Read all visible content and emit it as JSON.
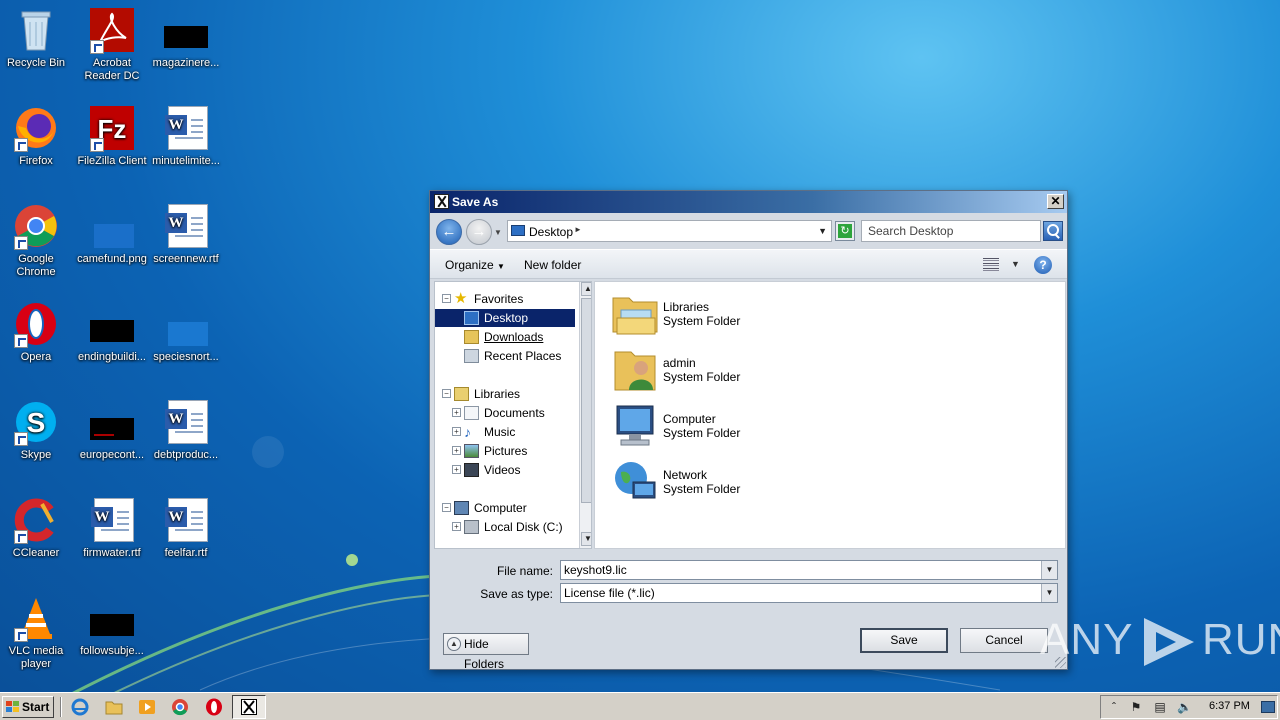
{
  "desktop": {
    "icons": [
      {
        "label": "Recycle Bin",
        "icon": "recycle-bin-icon"
      },
      {
        "label": "Acrobat Reader DC",
        "icon": "acrobat-reader-icon"
      },
      {
        "label": "magazinere...",
        "icon": "redacted-file-icon"
      },
      {
        "label": "Firefox",
        "icon": "firefox-icon"
      },
      {
        "label": "FileZilla Client",
        "icon": "filezilla-icon"
      },
      {
        "label": "minutelimite...",
        "icon": "word-document-icon"
      },
      {
        "label": "Google Chrome",
        "icon": "chrome-icon"
      },
      {
        "label": "camefund.png",
        "icon": "image-file-icon"
      },
      {
        "label": "screennew.rtf",
        "icon": "word-document-icon"
      },
      {
        "label": "Opera",
        "icon": "opera-icon"
      },
      {
        "label": "endingbuildi...",
        "icon": "redacted-file-icon"
      },
      {
        "label": "speciesnort...",
        "icon": "image-file-icon"
      },
      {
        "label": "Skype",
        "icon": "skype-icon"
      },
      {
        "label": "europecont...",
        "icon": "redacted-file-icon"
      },
      {
        "label": "debtproduc...",
        "icon": "word-document-icon"
      },
      {
        "label": "CCleaner",
        "icon": "ccleaner-icon"
      },
      {
        "label": "firmwater.rtf",
        "icon": "word-document-icon"
      },
      {
        "label": "feelfar.rtf",
        "icon": "word-document-icon"
      },
      {
        "label": "VLC media player",
        "icon": "vlc-icon"
      },
      {
        "label": "followsubje...",
        "icon": "redacted-file-icon"
      }
    ]
  },
  "dialog": {
    "title": "Save As",
    "close_label": "✕",
    "address": "Desktop",
    "search_placeholder": "Search Desktop",
    "toolbar": {
      "organize": "Organize",
      "new_folder": "New folder"
    },
    "nav_tree": {
      "favorites": "Favorites",
      "desktop": "Desktop",
      "downloads": "Downloads",
      "recent": "Recent Places",
      "libraries": "Libraries",
      "documents": "Documents",
      "music": "Music",
      "pictures": "Pictures",
      "videos": "Videos",
      "computer": "Computer",
      "local_disk": "Local Disk (C:)"
    },
    "items": [
      {
        "name": "Libraries",
        "type": "System Folder",
        "icon": "libraries-folder-icon"
      },
      {
        "name": "admin",
        "type": "System Folder",
        "icon": "user-folder-icon"
      },
      {
        "name": "Computer",
        "type": "System Folder",
        "icon": "computer-icon"
      },
      {
        "name": "Network",
        "type": "System Folder",
        "icon": "network-icon"
      }
    ],
    "file_name_label": "File name:",
    "file_name_value": "keyshot9.lic",
    "save_type_label": "Save as type:",
    "save_type_value": "License file (*.lic)",
    "hide_folders": "Hide Folders",
    "save": "Save",
    "cancel": "Cancel"
  },
  "taskbar": {
    "start": "Start",
    "clock": "6:37 PM"
  },
  "watermark": {
    "text_left": "ANY",
    "text_right": "RUN"
  }
}
